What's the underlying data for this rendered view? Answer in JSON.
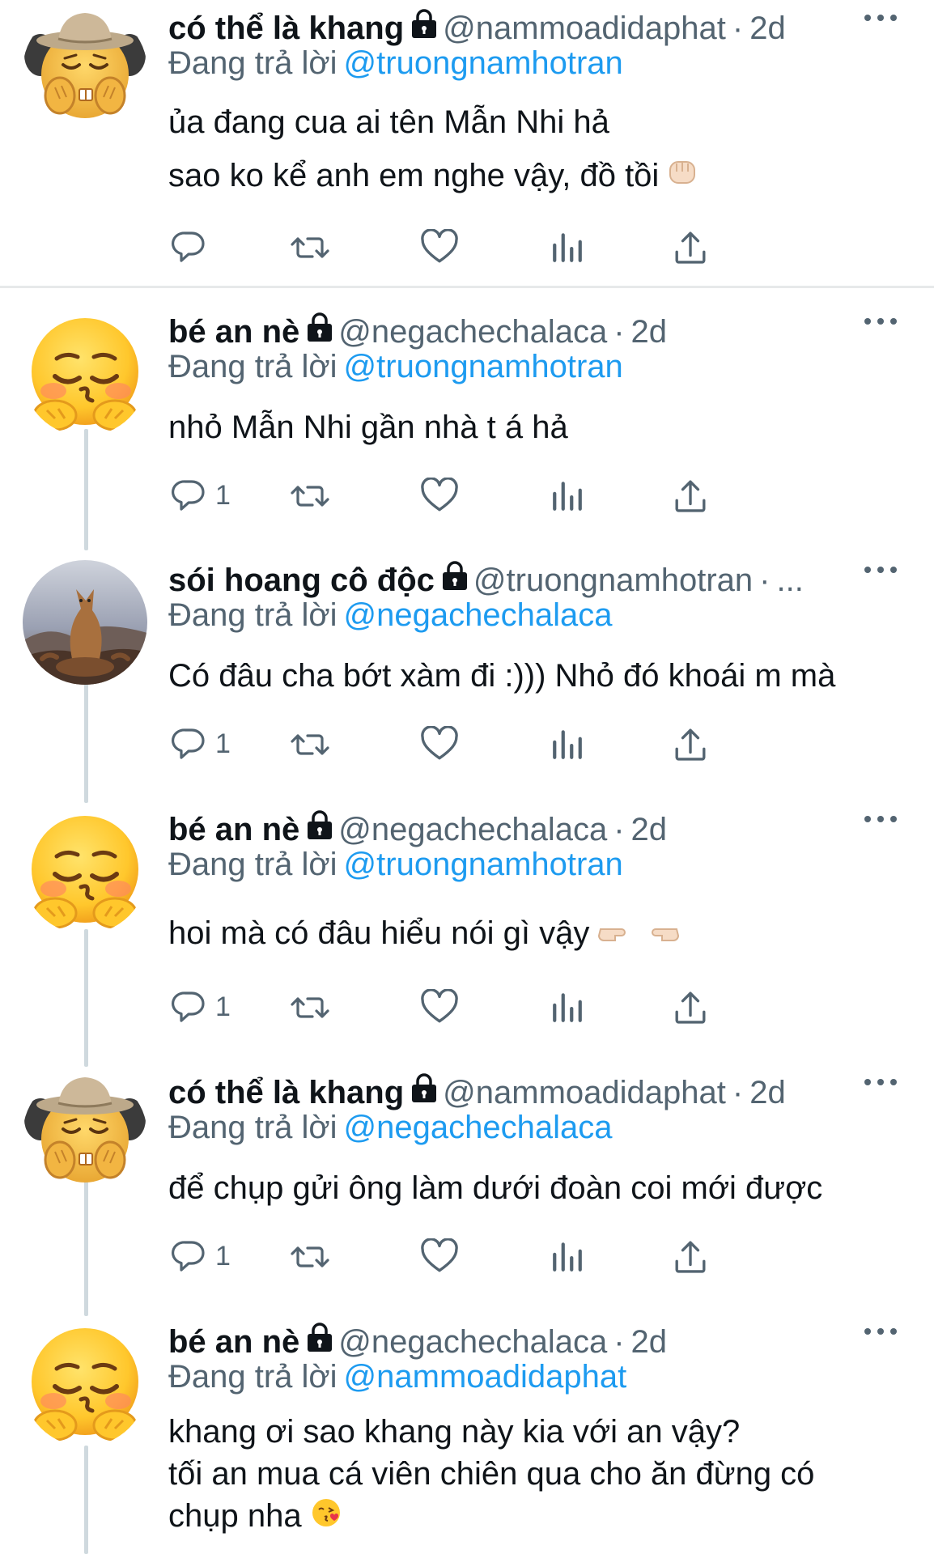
{
  "reply_prefix": "Đang trả lời",
  "separator": "·",
  "tweets": [
    {
      "name": "có thể là khang",
      "handle": "@nammoadidaphat",
      "time": "2d",
      "reply_to": "@truongnamhotran",
      "lines": [
        "ủa đang cua ai tên Mẫn Nhi hả",
        "sao ko kể anh em nghe vậy, đồ tồi"
      ],
      "reply_count": "",
      "avatar_icon": "cowboy-emoji-avatar"
    },
    {
      "name": "bé an nè",
      "handle": "@negachechalaca",
      "time": "2d",
      "reply_to": "@truongnamhotran",
      "lines": [
        "nhỏ Mẫn Nhi gần nhà t á hả"
      ],
      "reply_count": "1",
      "avatar_icon": "pleading-emoji-avatar"
    },
    {
      "name": "sói hoang cô độc",
      "handle": "@truongnamhotran",
      "time": "...",
      "reply_to": "@negachechalaca",
      "lines": [
        "Có đâu cha bớt xàm đi :))) Nhỏ đó khoái m mà"
      ],
      "reply_count": "1",
      "avatar_icon": "wolf-photo-avatar"
    },
    {
      "name": "bé an nè",
      "handle": "@negachechalaca",
      "time": "2d",
      "reply_to": "@truongnamhotran",
      "lines": [
        "hoi mà có đâu hiểu nói gì vậy"
      ],
      "reply_count": "1",
      "avatar_icon": "pleading-emoji-avatar"
    },
    {
      "name": "có thể là khang",
      "handle": "@nammoadidaphat",
      "time": "2d",
      "reply_to": "@negachechalaca",
      "lines": [
        "để chụp gửi ông làm dưới đoàn coi mới được"
      ],
      "reply_count": "1",
      "avatar_icon": "cowboy-emoji-avatar"
    },
    {
      "name": "bé an nè",
      "handle": "@negachechalaca",
      "time": "2d",
      "reply_to": "@nammoadidaphat",
      "lines": [
        "khang ơi sao khang này kia với an vậy?",
        "tối an mua cá viên chiên qua cho ăn đừng có",
        "chụp nha"
      ],
      "reply_count": "",
      "avatar_icon": "pleading-emoji-avatar"
    }
  ],
  "colors": {
    "text": "#0f1419",
    "secondary": "#536471",
    "link": "#1d9bf0",
    "divider": "#e7e9ea",
    "thread_line": "#cfd9de"
  }
}
